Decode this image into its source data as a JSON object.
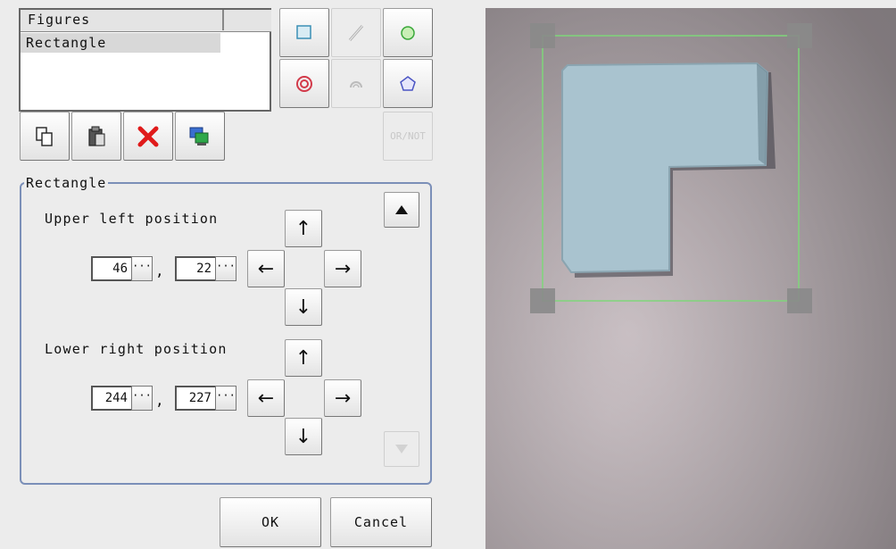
{
  "figures_list": {
    "header": "Figures",
    "items": [
      "Rectangle"
    ]
  },
  "tools": {
    "orlnot_label": "OR/NOT"
  },
  "rectangle_group": {
    "title": "Rectangle",
    "upper_left": {
      "label": "Upper left position",
      "x": "46",
      "y": "22"
    },
    "lower_right": {
      "label": "Lower right position",
      "x": "244",
      "y": "227"
    },
    "spin_dots": "···",
    "comma": ","
  },
  "arrows": {
    "up": "↑",
    "down": "↓",
    "left": "←",
    "right": "→"
  },
  "buttons": {
    "ok": "OK",
    "cancel": "Cancel"
  },
  "colors": {
    "selection_line": "#7fd67a",
    "group_border": "#7b8fb8",
    "delete_red": "#e01a1a"
  }
}
